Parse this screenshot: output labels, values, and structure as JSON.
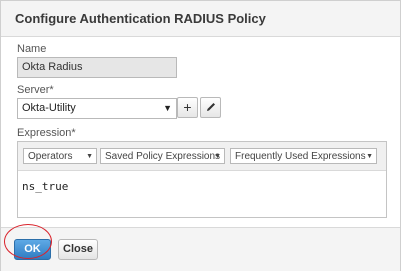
{
  "dialog": {
    "title": "Configure Authentication RADIUS Policy"
  },
  "form": {
    "name_label": "Name",
    "name_value": "Okta Radius",
    "server_label": "Server*",
    "server_value": "Okta-Utility",
    "add_icon": "plus-icon",
    "edit_icon": "pencil-icon",
    "expression_label": "Expression*",
    "expression_dropdowns": [
      "Operators",
      "Saved Policy Expressions",
      "Frequently Used Expressions"
    ],
    "expression_value": "ns_true"
  },
  "footer": {
    "ok_label": "OK",
    "close_label": "Close"
  },
  "colors": {
    "ok_button": "#2f7cc1",
    "annotation": "#d9232c"
  }
}
